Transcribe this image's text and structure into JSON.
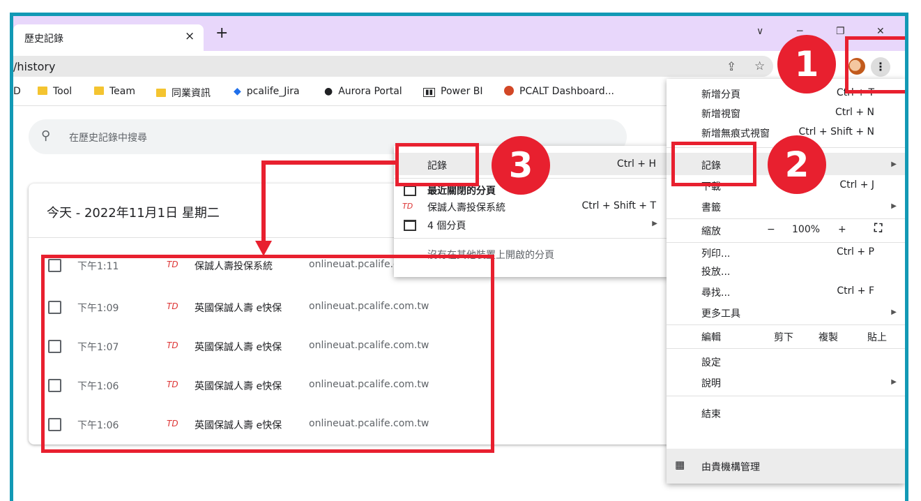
{
  "browser": {
    "tab_title": "歷史記錄",
    "tab_close": "×",
    "new_tab": "+",
    "window_controls": {
      "minimize": "∨",
      "maximize": "─",
      "restore": "❐",
      "close": "✕"
    },
    "url": "/history",
    "share_icon": "⇪",
    "star_icon": "☆",
    "menu_icon": "⋮"
  },
  "bookmarks": [
    {
      "label": "D",
      "icon": "none"
    },
    {
      "label": "Tool",
      "icon": "folder-icon"
    },
    {
      "label": "Team",
      "icon": "folder-icon"
    },
    {
      "label": "同業資訊",
      "icon": "folder-icon"
    },
    {
      "label": "pcalife_Jira",
      "icon": "jira-icon"
    },
    {
      "label": "Aurora Portal",
      "icon": "globe-icon"
    },
    {
      "label": "Power BI",
      "icon": "powerbi-icon"
    },
    {
      "label": "PCALT Dashboard...",
      "icon": "powerpoint-icon"
    }
  ],
  "history": {
    "search_placeholder": "在歷史記錄中搜尋",
    "day_header": "今天 - 2022年11月1日 星期二",
    "rows": [
      {
        "time": "下午1:11",
        "title": "保誠人壽投保系統",
        "url": "onlineuat.pcalife.c"
      },
      {
        "time": "下午1:09",
        "title": "英國保誠人壽 e快保",
        "url": "onlineuat.pcalife.com.tw"
      },
      {
        "time": "下午1:07",
        "title": "英國保誠人壽 e快保",
        "url": "onlineuat.pcalife.com.tw"
      },
      {
        "time": "下午1:06",
        "title": "英國保誠人壽 e快保",
        "url": "onlineuat.pcalife.com.tw"
      },
      {
        "time": "下午1:06",
        "title": "英國保誠人壽 e快保",
        "url": "onlineuat.pcalife.com.tw"
      }
    ]
  },
  "history_submenu": {
    "items": [
      {
        "label": "記錄",
        "shortcut": "Ctrl + H"
      },
      {
        "label": "最近關閉的分頁",
        "shortcut": ""
      },
      {
        "label": "保誠人壽投保系統",
        "shortcut": "Ctrl + Shift + T"
      },
      {
        "label": "4 個分頁",
        "shortcut": ""
      },
      {
        "label": "沒有在其他裝置上開啟的分頁",
        "shortcut": ""
      }
    ]
  },
  "main_menu": {
    "new_tab": {
      "label": "新增分頁",
      "shortcut": "Ctrl + T"
    },
    "new_window": {
      "label": "新增視窗",
      "shortcut": "Ctrl + N"
    },
    "incognito": {
      "label": "新增無痕式視窗",
      "shortcut": "Ctrl + Shift + N"
    },
    "history": {
      "label": "記錄"
    },
    "downloads": {
      "label": "下載",
      "shortcut": "Ctrl + J"
    },
    "bookmarks": {
      "label": "書籤"
    },
    "zoom": {
      "label": "縮放",
      "minus": "−",
      "value": "100%",
      "plus": "+"
    },
    "print": {
      "label": "列印...",
      "shortcut": "Ctrl + P"
    },
    "cast": {
      "label": "投放..."
    },
    "find": {
      "label": "尋找...",
      "shortcut": "Ctrl + F"
    },
    "more_tools": {
      "label": "更多工具"
    },
    "edit": {
      "label": "編輯",
      "cut": "剪下",
      "copy": "複製",
      "paste": "貼上"
    },
    "settings": {
      "label": "設定"
    },
    "help": {
      "label": "說明"
    },
    "exit": {
      "label": "結束"
    },
    "managed": {
      "label": "由貴機構管理"
    }
  },
  "annotations": {
    "step1": "1",
    "step2": "2",
    "step3": "3",
    "accent_color": "#e8202f",
    "frame_color": "#1299b5"
  }
}
